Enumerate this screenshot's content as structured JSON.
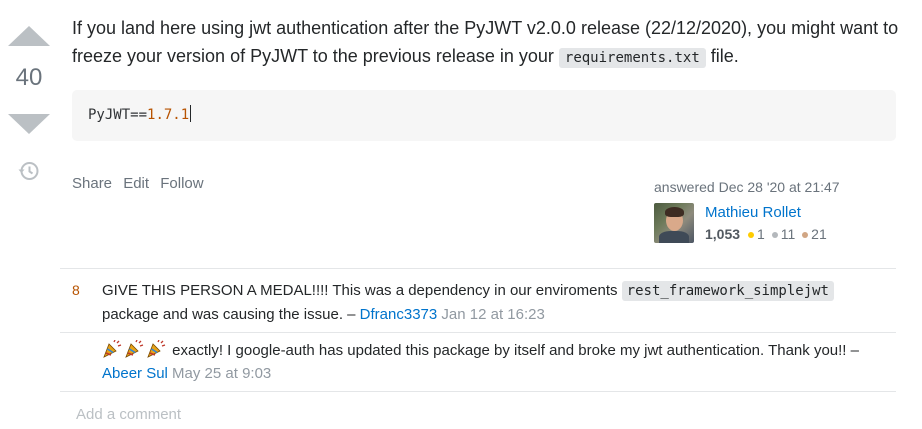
{
  "answer": {
    "score": "40",
    "body": {
      "text_before": "If you land here using jwt authentication after the PyJWT v2.0.0 release (22/12/2020), you might want to freeze your version of PyJWT to the previous release in your ",
      "inline_code": "requirements.txt",
      "text_after": " file."
    },
    "code": {
      "prefix": "PyJWT==",
      "version": "1.7.1"
    },
    "menu": {
      "share": "Share",
      "edit": "Edit",
      "follow": "Follow"
    },
    "signature": {
      "action": "answered Dec 28 '20 at 21:47",
      "user_name": "Mathieu Rollet",
      "reputation": "1,053",
      "gold": "1",
      "silver": "11",
      "bronze": "21"
    }
  },
  "comments": [
    {
      "score": "8",
      "text_before": "GIVE THIS PERSON A MEDAL!!!! This was a dependency in our enviroments ",
      "inline_code": "rest_framework_simplejwt",
      "text_after": " package and was causing the issue. – ",
      "user": "Dfranc3373",
      "date": "Jan 12 at 16:23"
    },
    {
      "score": "",
      "emoji": [
        "party-popper",
        "party-popper",
        "party-popper"
      ],
      "text": " exactly! I google-auth has updated this package by itself and broke my jwt authentication. Thank you!! – ",
      "user": "Abeer Sul",
      "date": "May 25 at 9:03"
    }
  ],
  "add_comment": "Add a comment",
  "colors": {
    "link": "#0074cc",
    "muted": "#6a737c",
    "score_accent": "#b75301",
    "code_bg": "#f6f6f6"
  }
}
